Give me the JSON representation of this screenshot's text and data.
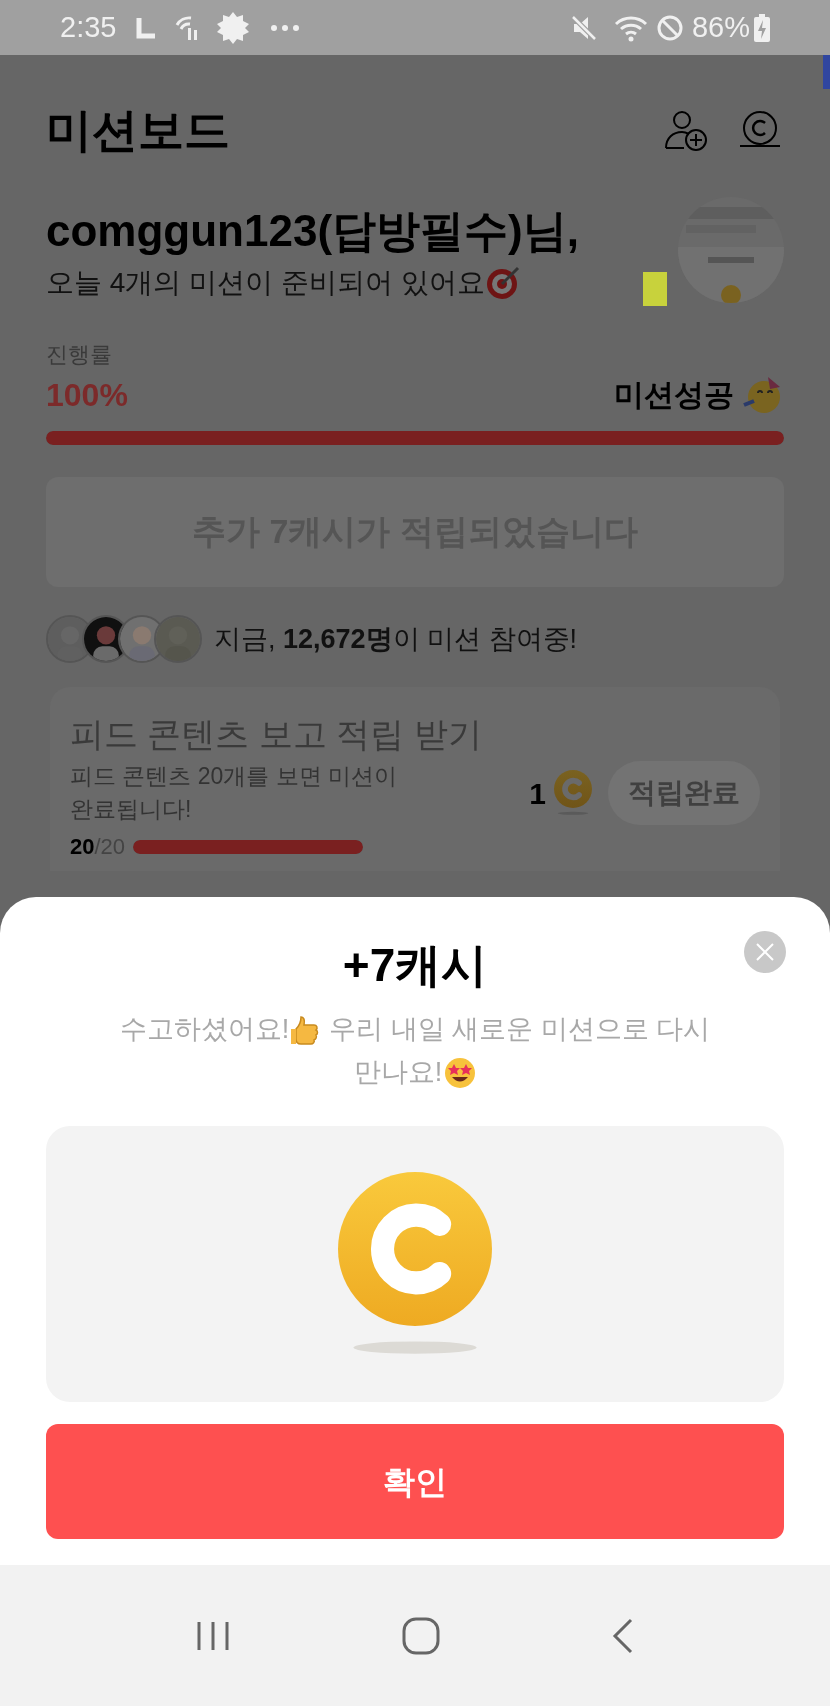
{
  "status_bar": {
    "time": "2:35",
    "battery": "86%"
  },
  "header": {
    "title": "미션보드"
  },
  "greeting": {
    "name": "comggun123(답방필수)님,",
    "message": "오늘 4개의 미션이 준비되어 있어요"
  },
  "progress": {
    "label": "진행률",
    "value": "100%",
    "level": 1,
    "status": "미션성공"
  },
  "notice": "추가 7캐시가 적립되었습니다",
  "participants": {
    "text": "지금, **12,672명**이 미션 참여중!"
  },
  "missions": [
    {
      "title": "피드 콘텐츠 보고 적립 받기",
      "description": "피드 콘텐츠 20개를 보면 미션이 완료됩니다!",
      "reward": "1",
      "button": "적립완료",
      "count": "20",
      "total": "/20",
      "level": 1
    }
  ],
  "sheet": {
    "title": "+7캐시",
    "message_1": "수고하셨어요!",
    "message_2": "우리 내일 새로운 미션으로 다시",
    "message_3": "만나요!",
    "confirm": "확인"
  }
}
